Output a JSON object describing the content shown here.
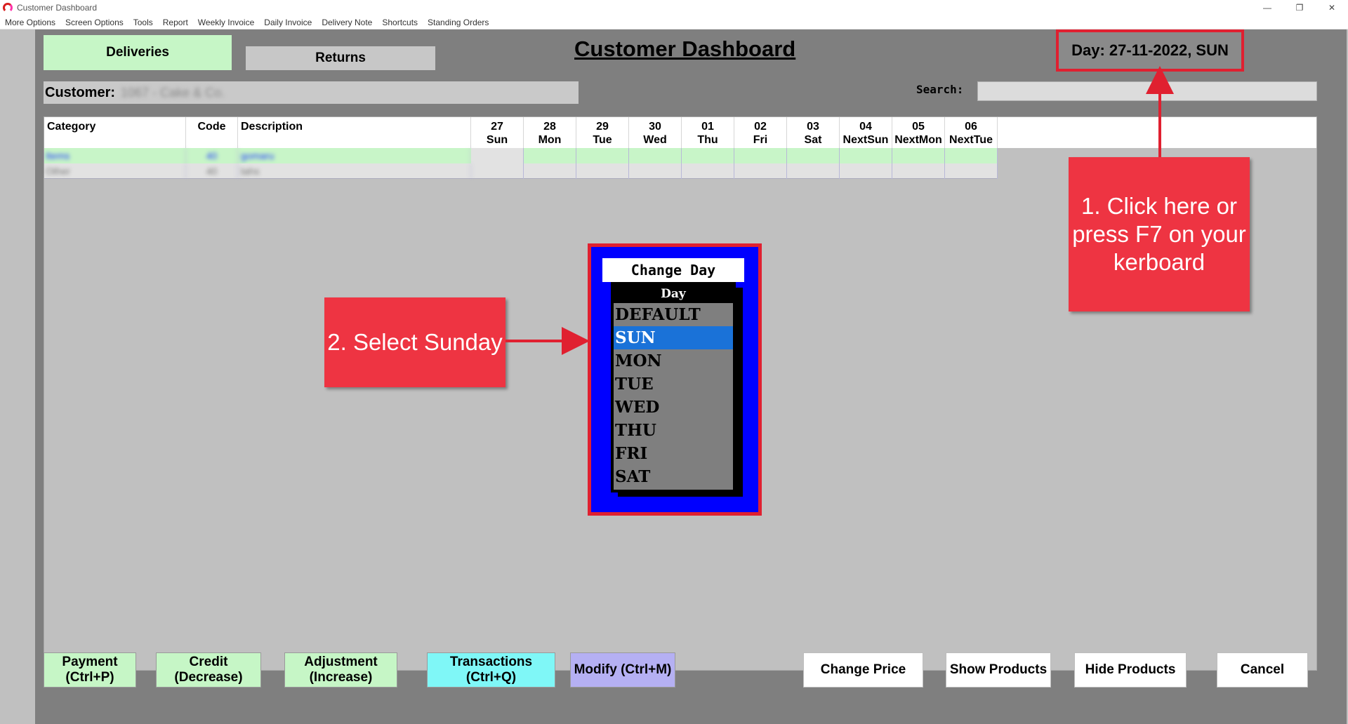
{
  "window": {
    "title": "Customer Dashboard",
    "minimize": "—",
    "restore": "❐",
    "close": "✕"
  },
  "menu": [
    "More Options",
    "Screen Options",
    "Tools",
    "Report",
    "Weekly Invoice",
    "Daily Invoice",
    "Delivery Note",
    "Shortcuts",
    "Standing Orders"
  ],
  "tabs": {
    "deliveries": "Deliveries",
    "returns": "Returns"
  },
  "page_title": "Customer Dashboard",
  "day_label": "Day: 27-11-2022, SUN",
  "customer": {
    "label": "Customer:",
    "value": "1067 - Cake & Co."
  },
  "search": {
    "label": "Search:",
    "value": ""
  },
  "grid": {
    "headers": {
      "category": "Category",
      "code": "Code",
      "description": "Description",
      "days": [
        {
          "num": "27",
          "day": "Sun"
        },
        {
          "num": "28",
          "day": "Mon"
        },
        {
          "num": "29",
          "day": "Tue"
        },
        {
          "num": "30",
          "day": "Wed"
        },
        {
          "num": "01",
          "day": "Thu"
        },
        {
          "num": "02",
          "day": "Fri"
        },
        {
          "num": "03",
          "day": "Sat"
        },
        {
          "num": "04",
          "day": "NextSun"
        },
        {
          "num": "05",
          "day": "NextMon"
        },
        {
          "num": "06",
          "day": "NextTue"
        }
      ]
    },
    "rows": [
      {
        "category": "Items",
        "code": "40",
        "description": "gomaru"
      },
      {
        "category": "Other",
        "code": "40",
        "description": "tahs"
      }
    ]
  },
  "change_day_dialog": {
    "title": "Change Day",
    "list_header": "Day",
    "options": [
      "DEFAULT",
      "SUN",
      "MON",
      "TUE",
      "WED",
      "THU",
      "FRI",
      "SAT"
    ],
    "selected": "SUN"
  },
  "callouts": {
    "step1": "1. Click here or press F7 on your kerboard",
    "step2": "2. Select Sunday"
  },
  "footer": {
    "payment": "Payment (Ctrl+P)",
    "credit": "Credit (Decrease)",
    "adjustment": "Adjustment (Increase)",
    "transactions": "Transactions (Ctrl+Q)",
    "modify": "Modify (Ctrl+M)",
    "change_price": "Change Price",
    "show_products": "Show Products",
    "hide_products": "Hide Products",
    "cancel": "Cancel"
  },
  "colors": {
    "callout": "#ee3442",
    "selected": "#1a72d8",
    "dialog": "#0000ff",
    "green": "#c6f6c6"
  }
}
